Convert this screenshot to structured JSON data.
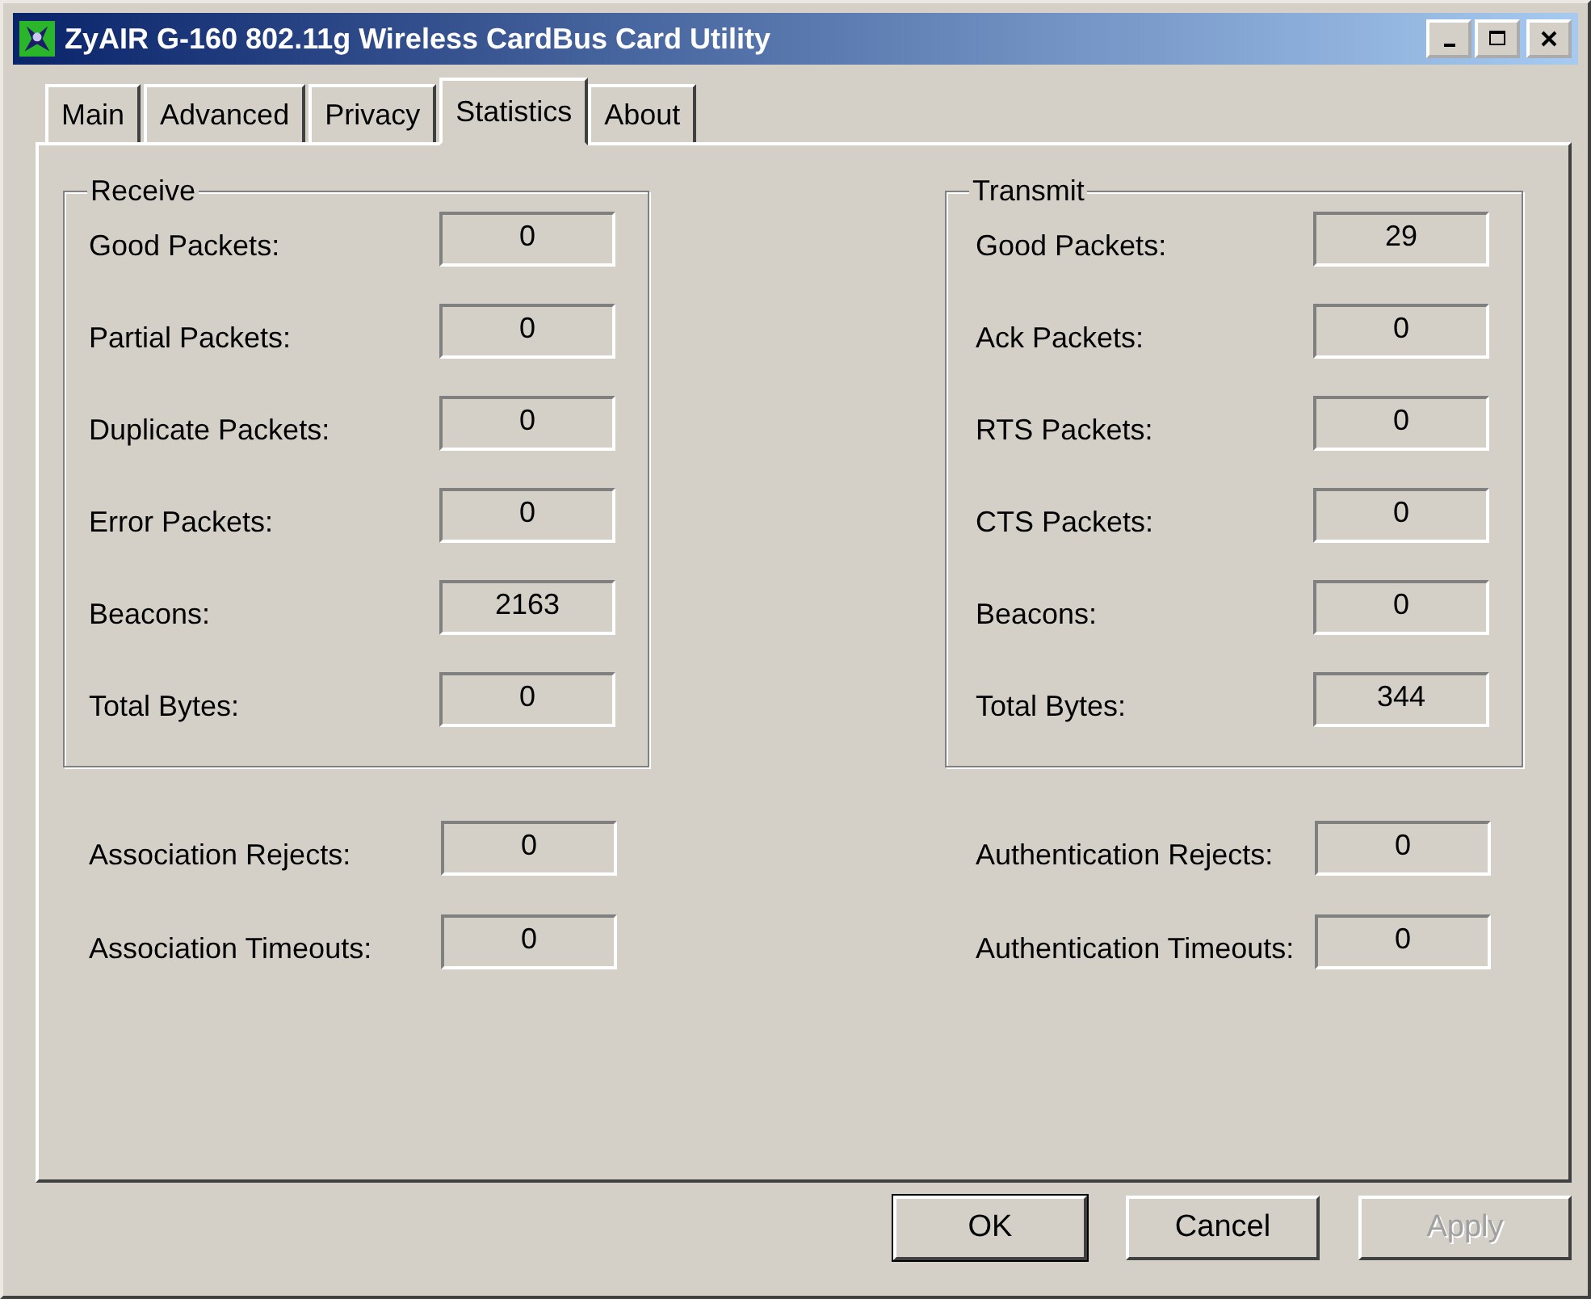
{
  "window": {
    "title": "ZyAIR G-160 802.11g Wireless CardBus Card Utility"
  },
  "tabs": [
    {
      "label": "Main",
      "selected": false
    },
    {
      "label": "Advanced",
      "selected": false
    },
    {
      "label": "Privacy",
      "selected": false
    },
    {
      "label": "Statistics",
      "selected": true
    },
    {
      "label": "About",
      "selected": false
    }
  ],
  "receive": {
    "title": "Receive",
    "rows": [
      {
        "label": "Good Packets:",
        "value": "0"
      },
      {
        "label": "Partial Packets:",
        "value": "0"
      },
      {
        "label": "Duplicate Packets:",
        "value": "0"
      },
      {
        "label": "Error Packets:",
        "value": "0"
      },
      {
        "label": "Beacons:",
        "value": "2163"
      },
      {
        "label": "Total Bytes:",
        "value": "0"
      }
    ]
  },
  "transmit": {
    "title": "Transmit",
    "rows": [
      {
        "label": "Good Packets:",
        "value": "29"
      },
      {
        "label": "Ack Packets:",
        "value": "0"
      },
      {
        "label": "RTS Packets:",
        "value": "0"
      },
      {
        "label": "CTS Packets:",
        "value": "0"
      },
      {
        "label": "Beacons:",
        "value": "0"
      },
      {
        "label": "Total Bytes:",
        "value": "344"
      }
    ]
  },
  "association": [
    {
      "label": "Association Rejects:",
      "value": "0"
    },
    {
      "label": "Association Timeouts:",
      "value": "0"
    }
  ],
  "authentication": [
    {
      "label": "Authentication Rejects:",
      "value": "0"
    },
    {
      "label": "Authentication Timeouts:",
      "value": "0"
    }
  ],
  "buttons": [
    {
      "label": "OK",
      "default": true,
      "disabled": false
    },
    {
      "label": "Cancel",
      "default": false,
      "disabled": false
    },
    {
      "label": "Apply",
      "default": false,
      "disabled": true
    }
  ]
}
